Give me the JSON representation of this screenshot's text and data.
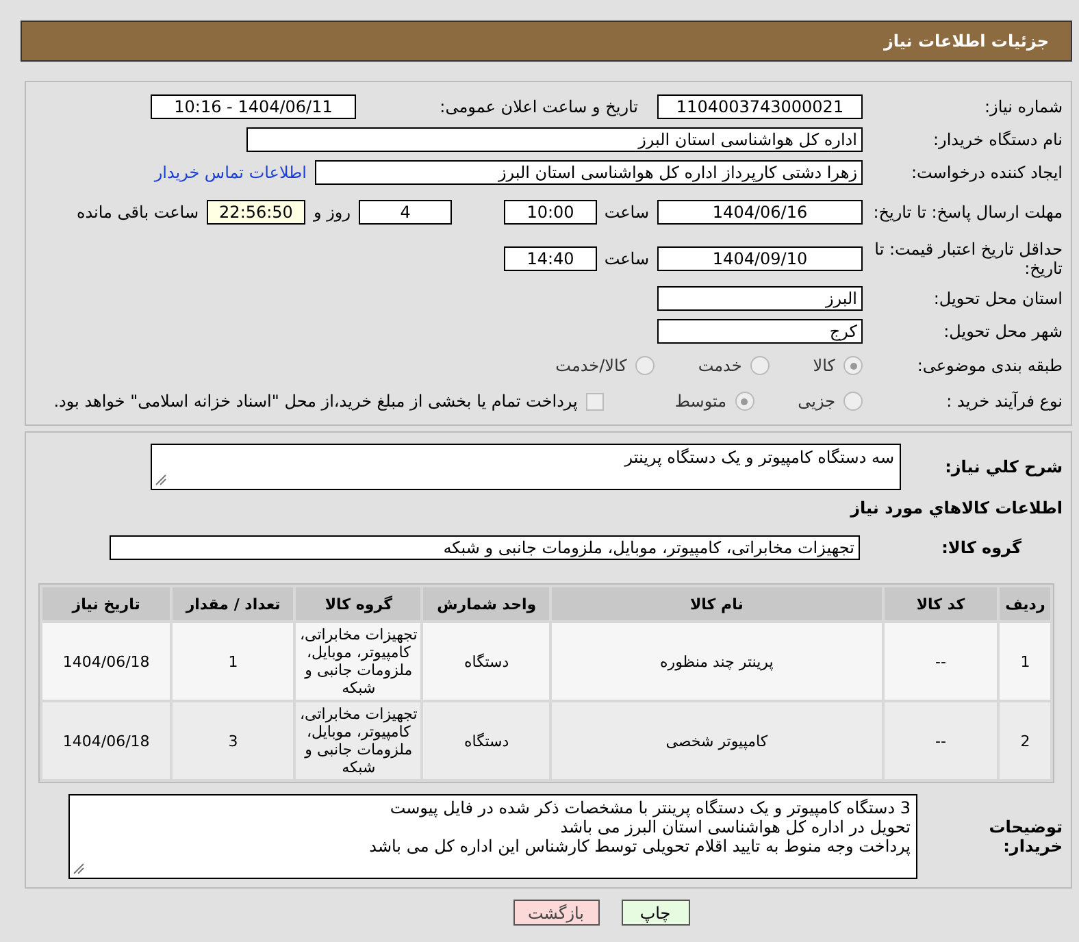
{
  "header": {
    "title": "جزئیات اطلاعات نیاز"
  },
  "need_number": {
    "label": "شماره نیاز:",
    "value": "1104003743000021"
  },
  "announce": {
    "label": "تاریخ و ساعت اعلان عمومی:",
    "value": "1404/06/11 - 10:16"
  },
  "buyer": {
    "label": "نام دستگاه خریدار:",
    "value": "اداره کل هواشناسی استان البرز"
  },
  "creator": {
    "label": "ایجاد کننده درخواست:",
    "value": "زهرا دشتی کارپرداز اداره کل هواشناسی استان البرز",
    "link": "اطلاعات تماس خریدار"
  },
  "deadline": {
    "label": "مهلت ارسال پاسخ: تا تاریخ:",
    "date": "1404/06/16",
    "time_label": "ساعت",
    "time": "10:00",
    "days": "4",
    "days_label": "روز و",
    "remaining": "22:56:50",
    "remaining_label": "ساعت باقی مانده"
  },
  "validity": {
    "label": "حداقل تاریخ اعتبار قیمت: تا تاریخ:",
    "date": "1404/09/10",
    "time_label": "ساعت",
    "time": "14:40"
  },
  "province": {
    "label": "استان محل تحویل:",
    "value": "البرز"
  },
  "city": {
    "label": "شهر محل تحویل:",
    "value": "کرج"
  },
  "category": {
    "label": "طبقه بندی موضوعی:",
    "options": [
      {
        "label": "کالا",
        "selected": true
      },
      {
        "label": "خدمت",
        "selected": false
      },
      {
        "label": "کالا/خدمت",
        "selected": false
      }
    ]
  },
  "process": {
    "label": "نوع فرآیند خرید :",
    "options": [
      {
        "label": "جزیی",
        "selected": false
      },
      {
        "label": "متوسط",
        "selected": true
      }
    ],
    "treasury": {
      "checked": false,
      "label": "پرداخت تمام یا بخشی از مبلغ خرید،از محل \"اسناد خزانه اسلامی\" خواهد بود."
    }
  },
  "summary": {
    "label": "شرح کلي نياز:",
    "value": "سه دستگاه کامپیوتر و یک دستگاه پرینتر"
  },
  "goods_heading": "اطلاعات کالاهاي مورد نیاز",
  "goods_group": {
    "label": "گروه کالا:",
    "value": "تجهیزات مخابراتی، کامپیوتر، موبایل، ملزومات جانبی و شبکه"
  },
  "table": {
    "columns": [
      "ردیف",
      "کد کالا",
      "نام کالا",
      "واحد شمارش",
      "گروه کالا",
      "تعداد / مقدار",
      "تاریخ نیاز"
    ],
    "rows": [
      [
        "1",
        "--",
        "پرینتر چند منظوره",
        "دستگاه",
        "تجهیزات مخابراتی، کامپیوتر، موبایل، ملزومات جانبی و شبکه",
        "1",
        "1404/06/18"
      ],
      [
        "2",
        "--",
        "کامپیوتر شخصی",
        "دستگاه",
        "تجهیزات مخابراتی، کامپیوتر، موبایل، ملزومات جانبی و شبکه",
        "3",
        "1404/06/18"
      ]
    ]
  },
  "notes": {
    "label": "توضیحات خریدار:",
    "lines": [
      "3 دستگاه کامپیوتر و یک دستگاه پرینتر با مشخصات ذکر شده در فایل پیوست",
      "تحویل در اداره کل هواشناسی استان البرز می باشد",
      "پرداخت وجه منوط به تایید اقلام تحویلی توسط کارشناس این اداره کل می باشد"
    ]
  },
  "buttons": [
    {
      "label": "چاپ",
      "kind": "print"
    },
    {
      "label": "بازگشت",
      "kind": "back"
    }
  ]
}
